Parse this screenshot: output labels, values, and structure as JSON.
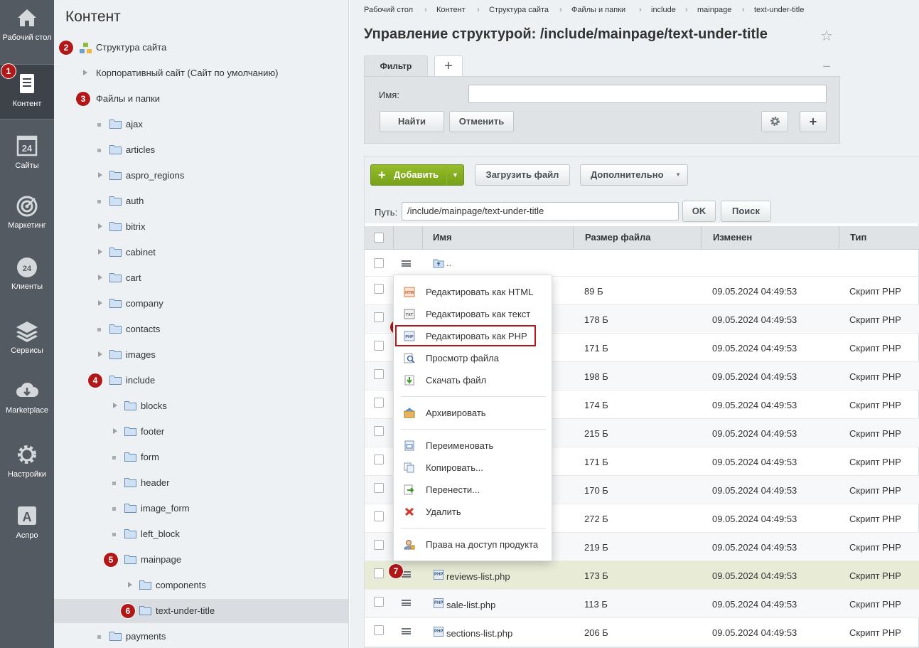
{
  "left_nav": {
    "items": [
      {
        "label": "Рабочий стол",
        "icon": "home-icon"
      },
      {
        "label": "Контент",
        "icon": "document-icon",
        "active": true
      },
      {
        "label": "Сайты",
        "icon": "calendar-24-icon"
      },
      {
        "label": "Маркетинг",
        "icon": "target-icon"
      },
      {
        "label": "Клиенты",
        "icon": "crm-24-icon"
      },
      {
        "label": "Сервисы",
        "icon": "layers-icon"
      },
      {
        "label": "Marketplace",
        "icon": "cloud-download-icon"
      },
      {
        "label": "Настройки",
        "icon": "gear-icon"
      },
      {
        "label": "Аспро",
        "icon": "letter-a-icon"
      }
    ]
  },
  "tree": {
    "title": "Контент",
    "site_structure": "Структура сайта",
    "corporate_site": "Корпоративный сайт (Сайт по умолчанию)",
    "files_and_folders": "Файлы и папки",
    "folders": [
      "ajax",
      "articles",
      "aspro_regions",
      "auth",
      "bitrix",
      "cabinet",
      "cart",
      "company",
      "contacts",
      "images",
      "include"
    ],
    "include_children": [
      "blocks",
      "footer",
      "form",
      "header",
      "image_form",
      "left_block",
      "mainpage"
    ],
    "mainpage_children": [
      "components",
      "text-under-title"
    ],
    "after": [
      "payments"
    ]
  },
  "annotations": [
    "1",
    "2",
    "3",
    "4",
    "5",
    "6",
    "7",
    "8"
  ],
  "breadcrumbs": [
    "Рабочий стол",
    "Контент",
    "Структура сайта",
    "Файлы и папки",
    "include",
    "mainpage",
    "text-under-title"
  ],
  "page_title": "Управление структурой: /include/mainpage/text-under-title",
  "filter": {
    "tab_label": "Фильтр",
    "add_tab": "+",
    "minimize": "–",
    "name_label": "Имя:",
    "name_value": "",
    "find": "Найти",
    "cancel": "Отменить",
    "add": "+"
  },
  "toolbar": {
    "add": "Добавить",
    "upload": "Загрузить файл",
    "more": "Дополнительно",
    "path_label": "Путь:",
    "path_value": "/include/mainpage/text-under-title",
    "ok": "OK",
    "search": "Поиск"
  },
  "table": {
    "columns": [
      "Имя",
      "Размер файла",
      "Изменен",
      "Тип"
    ],
    "up_label": "..",
    "rows": [
      {
        "name": "",
        "size": "89 Б",
        "modified": "09.05.2024 04:49:53",
        "type": "Скрипт PHP"
      },
      {
        "name": "",
        "size": "178 Б",
        "modified": "09.05.2024 04:49:53",
        "type": "Скрипт PHP"
      },
      {
        "name": "",
        "size": "171 Б",
        "modified": "09.05.2024 04:49:53",
        "type": "Скрипт PHP"
      },
      {
        "name": "",
        "size": "198 Б",
        "modified": "09.05.2024 04:49:53",
        "type": "Скрипт PHP"
      },
      {
        "name": "",
        "size": "174 Б",
        "modified": "09.05.2024 04:49:53",
        "type": "Скрипт PHP"
      },
      {
        "name": "",
        "size": "215 Б",
        "modified": "09.05.2024 04:49:53",
        "type": "Скрипт PHP"
      },
      {
        "name": "",
        "size": "171 Б",
        "modified": "09.05.2024 04:49:53",
        "type": "Скрипт PHP"
      },
      {
        "name": "",
        "size": "170 Б",
        "modified": "09.05.2024 04:49:53",
        "type": "Скрипт PHP"
      },
      {
        "name": "",
        "size": "272 Б",
        "modified": "09.05.2024 04:49:53",
        "type": "Скрипт PHP"
      },
      {
        "name": "",
        "size": "219 Б",
        "modified": "09.05.2024 04:49:53",
        "type": "Скрипт PHP"
      },
      {
        "name": "reviews-list.php",
        "size": "173 Б",
        "modified": "09.05.2024 04:49:53",
        "type": "Скрипт PHP"
      },
      {
        "name": "sale-list.php",
        "size": "113 Б",
        "modified": "09.05.2024 04:49:53",
        "type": "Скрипт PHP"
      },
      {
        "name": "sections-list.php",
        "size": "206 Б",
        "modified": "09.05.2024 04:49:53",
        "type": "Скрипт PHP"
      }
    ]
  },
  "context_menu": {
    "items": [
      {
        "label": "Редактировать как HTML",
        "icon": "html-file-icon"
      },
      {
        "label": "Редактировать как текст",
        "icon": "txt-file-icon"
      },
      {
        "label": "Редактировать как PHP",
        "icon": "php-file-icon"
      },
      {
        "label": "Просмотр файла",
        "icon": "magnifier-icon"
      },
      {
        "label": "Скачать файл",
        "icon": "download-icon"
      },
      {
        "label": "Архивировать",
        "icon": "archive-icon"
      },
      {
        "label": "Переименовать",
        "icon": "rename-icon"
      },
      {
        "label": "Копировать...",
        "icon": "copy-icon"
      },
      {
        "label": "Перенести...",
        "icon": "move-icon"
      },
      {
        "label": "Удалить",
        "icon": "delete-icon"
      },
      {
        "label": "Права на доступ продукта",
        "icon": "access-rights-icon"
      }
    ]
  },
  "colors": {
    "nav_bg": "#545a61",
    "annotation_red": "#b21818",
    "add_green": "#7ea51d",
    "highlight_row": "#e8ecd7"
  }
}
